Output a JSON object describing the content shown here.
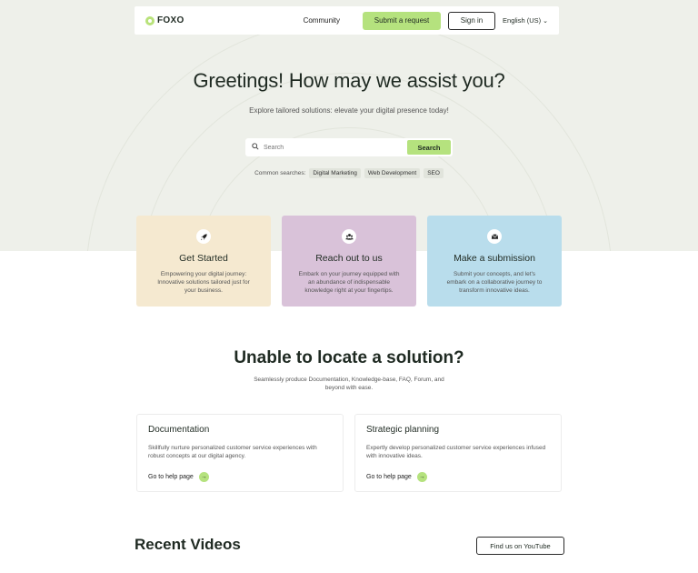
{
  "header": {
    "logo_text": "FOXO",
    "community_label": "Community",
    "submit_request_label": "Submit a request",
    "sign_in_label": "Sign in",
    "language_label": "English (US)"
  },
  "hero": {
    "title": "Greetings! How may we assist you?",
    "subtitle": "Explore tailored solutions: elevate your digital presence today!",
    "search": {
      "placeholder": "Search",
      "button_label": "Search"
    },
    "common_searches_label": "Common searches:",
    "common_searches": [
      "Digital Marketing",
      "Web Development",
      "SEO"
    ]
  },
  "cards": [
    {
      "title": "Get Started",
      "text": "Empowering your digital journey: Innovative solutions tailored just for your business.",
      "icon": "rocket-icon",
      "color": "#f5e9d0"
    },
    {
      "title": "Reach out to us",
      "text": "Embark on your journey equipped with an abundance of indispensable knowledge right at your fingertips.",
      "icon": "users-icon",
      "color": "#d9c2d9"
    },
    {
      "title": "Make a submission",
      "text": "Submit your concepts, and let's embark on a collaborative journey to transform innovative ideas.",
      "icon": "inbox-icon",
      "color": "#b9ddec"
    }
  ],
  "solution": {
    "title": "Unable to locate a solution?",
    "subtitle": "Seamlessly produce Documentation, Knowledge-base, FAQ, Forum, and beyond with ease.",
    "items": [
      {
        "title": "Documentation",
        "text": "Skillfully nurture personalized customer service experiences with robust concepts at our digital agency.",
        "link_label": "Go to help page"
      },
      {
        "title": "Strategic planning",
        "text": "Expertly develop personalized customer service experiences infused with innovative ideas.",
        "link_label": "Go to help page"
      }
    ]
  },
  "videos": {
    "title": "Recent Videos",
    "youtube_label": "Find us on YouTube"
  },
  "colors": {
    "accent": "#b5e27e",
    "hero_bg": "#eef0ea",
    "text": "#1f2a22"
  }
}
